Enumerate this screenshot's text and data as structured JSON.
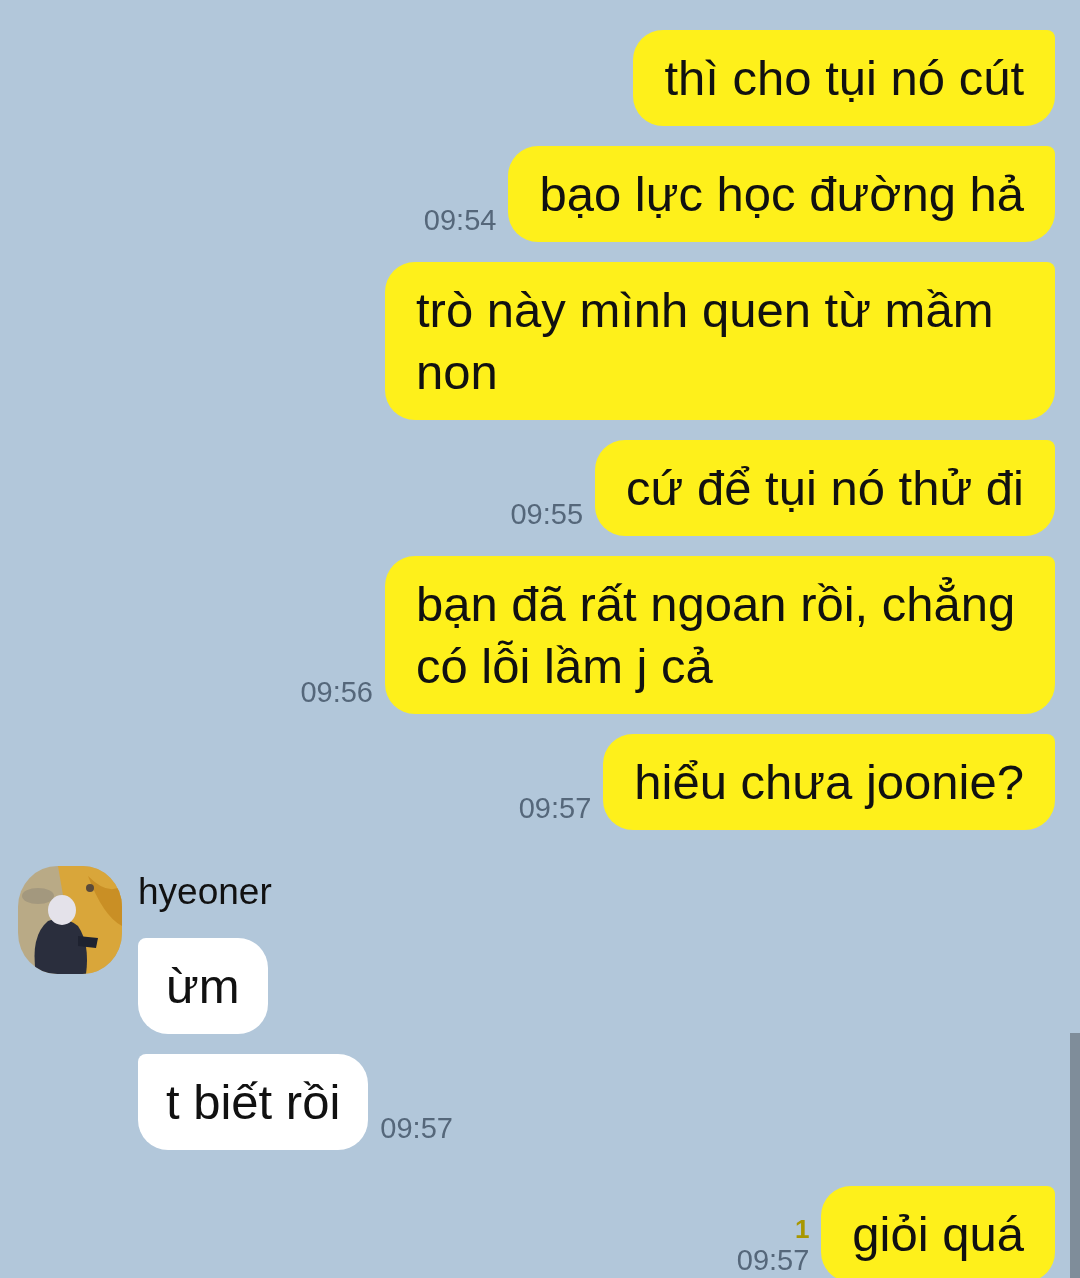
{
  "messages": [
    {
      "kind": "sent",
      "text": "thì cho tụi nó cút"
    },
    {
      "kind": "sent",
      "text": "bạo lực học đường hả",
      "time": "09:54"
    },
    {
      "kind": "sent",
      "text": "trò này mình quen từ mầm non"
    },
    {
      "kind": "sent",
      "text": "cứ để tụi nó thử đi",
      "time": "09:55"
    },
    {
      "kind": "sent",
      "text": "bạn đã rất ngoan rồi, chẳng có lỗi lầm j cả",
      "time": "09:56"
    },
    {
      "kind": "sent",
      "text": "hiểu chưa joonie?",
      "time": "09:57"
    },
    {
      "kind": "received",
      "sender": "hyeoner",
      "bubbles": [
        {
          "text": "ừm"
        },
        {
          "text": "t biết rồi",
          "time": "09:57"
        }
      ]
    },
    {
      "kind": "sent",
      "text": "giỏi quá",
      "time": "09:57",
      "unread": "1"
    }
  ]
}
